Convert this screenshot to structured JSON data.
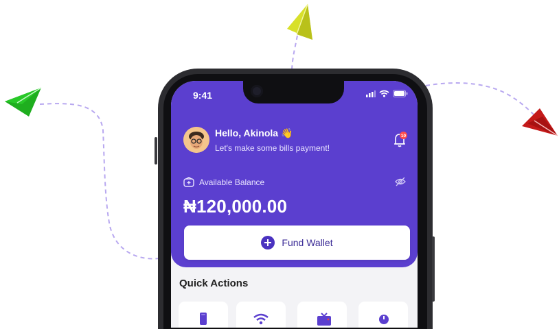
{
  "status_bar": {
    "time": "9:41"
  },
  "header": {
    "greeting": "Hello, Akinola 👋",
    "subtitle": "Let's make some bills payment!",
    "notification_count": "10"
  },
  "wallet": {
    "balance_label": "Available Balance",
    "balance_amount": "₦120,000.00",
    "fund_button_label": "Fund Wallet"
  },
  "quick_actions": {
    "title": "Quick Actions",
    "items": [
      {
        "icon": "phone-icon"
      },
      {
        "icon": "wifi-icon"
      },
      {
        "icon": "tv-icon"
      },
      {
        "icon": "power-icon"
      }
    ]
  },
  "colors": {
    "brand": "#5b3fcf",
    "notification_badge": "#ff4d4d",
    "plane_yellow": "#d8e02a",
    "plane_green": "#1fae1f",
    "plane_red": "#c41a1a",
    "dash_path": "#b8a8f0"
  }
}
